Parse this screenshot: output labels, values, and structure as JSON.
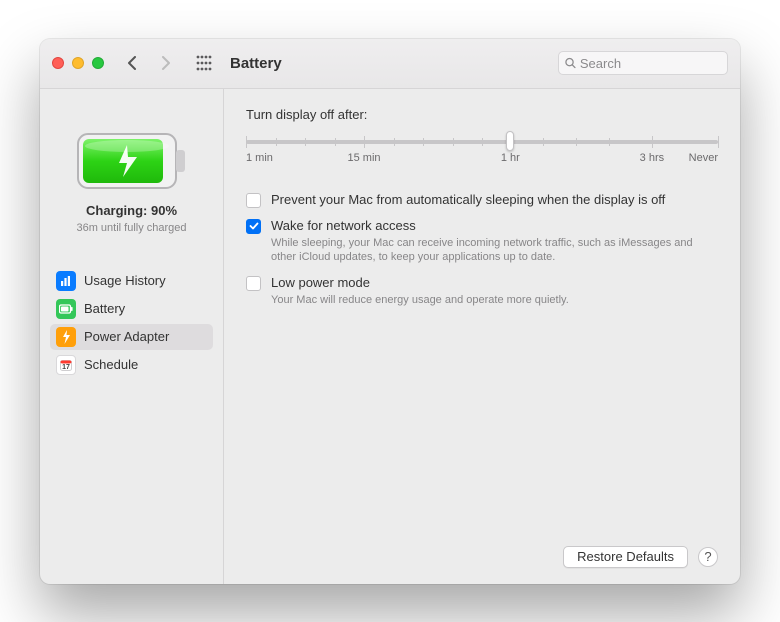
{
  "header": {
    "title": "Battery",
    "search_placeholder": "Search"
  },
  "sidebar": {
    "charge_label": "Charging: 90%",
    "charge_sub": "36m until fully charged",
    "items": [
      {
        "label": "Usage History"
      },
      {
        "label": "Battery"
      },
      {
        "label": "Power Adapter"
      },
      {
        "label": "Schedule"
      }
    ]
  },
  "content": {
    "slider_label": "Turn display off after:",
    "ticks": {
      "t0": "1 min",
      "t1": "15 min",
      "t2": "1 hr",
      "t3": "3 hrs",
      "t4": "Never"
    },
    "options": [
      {
        "label": "Prevent your Mac from automatically sleeping when the display is off",
        "desc": "",
        "checked": false
      },
      {
        "label": "Wake for network access",
        "desc": "While sleeping, your Mac can receive incoming network traffic, such as iMessages and other iCloud updates, to keep your applications up to date.",
        "checked": true
      },
      {
        "label": "Low power mode",
        "desc": "Your Mac will reduce energy usage and operate more quietly.",
        "checked": false
      }
    ],
    "restore_label": "Restore Defaults",
    "help_label": "?"
  }
}
